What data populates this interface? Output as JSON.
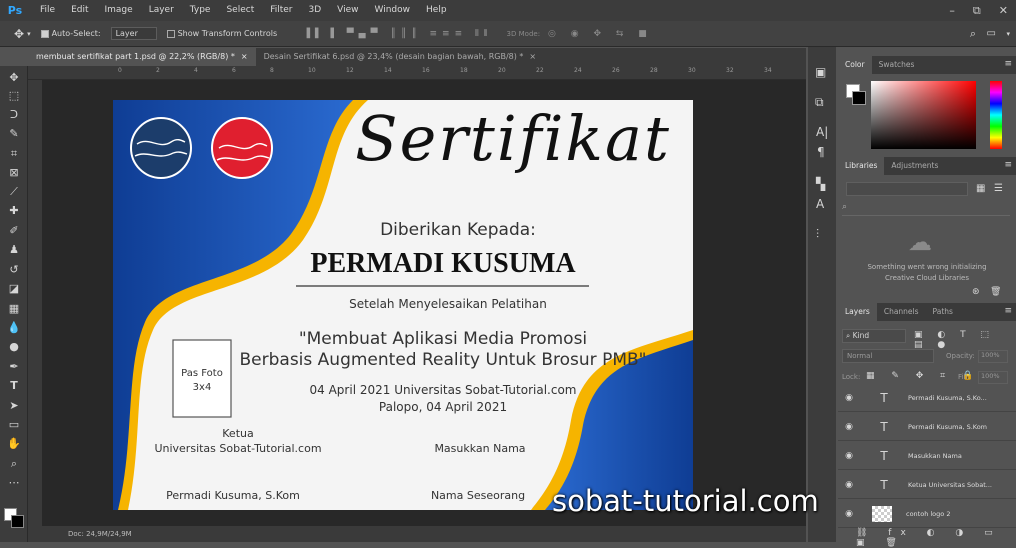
{
  "app": {
    "logo": "Ps"
  },
  "menu": [
    "File",
    "Edit",
    "Image",
    "Layer",
    "Type",
    "Select",
    "Filter",
    "3D",
    "View",
    "Window",
    "Help"
  ],
  "window_controls": [
    "–",
    "⧉",
    "✕"
  ],
  "options": {
    "auto_select_label": "Auto-Select:",
    "auto_select_value": "Layer",
    "show_transform_label": "Show Transform Controls",
    "mode_3d": "3D Mode:"
  },
  "tabs": [
    {
      "label": "membuat sertifikat part 1.psd @ 22,2% (RGB/8) *",
      "close": "×"
    },
    {
      "label": "Desain Sertifikat 6.psd @ 23,4% (desain bagian bawah, RGB/8) *",
      "close": "×"
    }
  ],
  "ruler": [
    "0",
    "2",
    "4",
    "6",
    "8",
    "10",
    "12",
    "14",
    "16",
    "18",
    "20",
    "22",
    "24",
    "26",
    "28",
    "30",
    "32",
    "34"
  ],
  "status": {
    "doc": "Doc: 24,9M/24,9M"
  },
  "certificate": {
    "title": "Sertifikat",
    "given_to": "Diberikan Kepada:",
    "name": "PERMADI KUSUMA",
    "after": "Setelah Menyelesaikan Pelatihan",
    "course_line1": "\"Membuat Aplikasi Media Promosi",
    "course_line2": "Berbasis Augmented Reality Untuk Brosur PMB\"",
    "date_line": "04 April 2021 Universitas Sobat-Tutorial.com",
    "place_date": "Palopo, 04 April 2021",
    "photo_line1": "Pas Foto",
    "photo_line2": "3x4",
    "sig_left_title": "Ketua",
    "sig_left_org": "Universitas Sobat-Tutorial.com",
    "sig_right_title": "Masukkan Nama",
    "sig_left_name": "Permadi Kusuma, S.Kom",
    "sig_right_name": "Nama Seseorang"
  },
  "panels": {
    "color_tabs": [
      "Color",
      "Swatches"
    ],
    "lib_tabs": [
      "Libraries",
      "Adjustments"
    ],
    "lib_error_line1": "Something went wrong initializing",
    "lib_error_line2": "Creative Cloud Libraries",
    "layer_tabs": [
      "Layers",
      "Channels",
      "Paths"
    ],
    "kind": "Kind",
    "blend": "Normal",
    "opacity_label": "Opacity:",
    "opacity": "100%",
    "lock_label": "Lock:",
    "fill_label": "Fill:",
    "fill": "100%",
    "layers": [
      {
        "name": "Permadi Kusuma, S.Ko..."
      },
      {
        "name": "Permadi Kusuma, S.Kom"
      },
      {
        "name": "Masukkan Nama"
      },
      {
        "name": "Ketua Universitas Sobat..."
      },
      {
        "name": "contoh logo 2"
      }
    ]
  },
  "watermark": "sobat-tutorial.com",
  "colors": {
    "blue": "#1d4fa8",
    "gold": "#f5b800",
    "logo_left": "#1c3d6b",
    "logo_right": "#e01f2f",
    "ps_blue": "#31a8ff"
  }
}
